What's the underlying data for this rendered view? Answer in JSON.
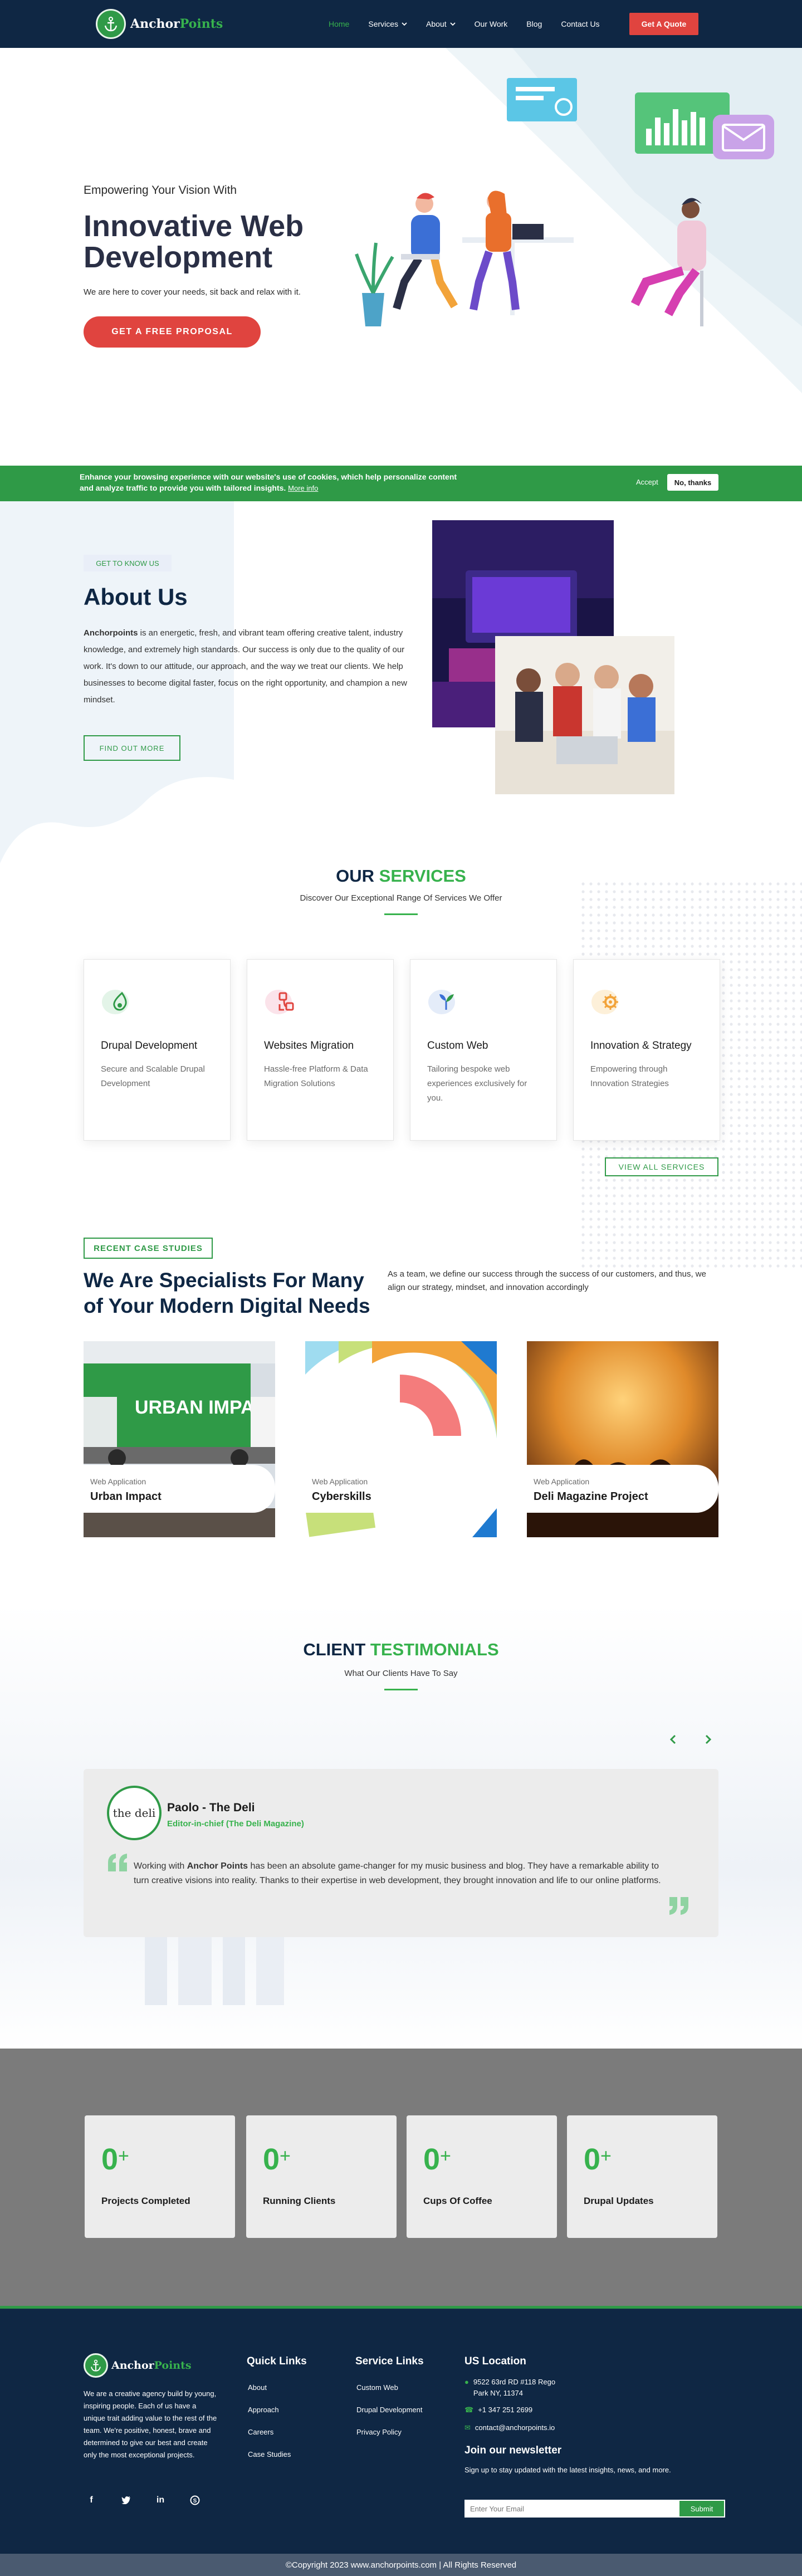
{
  "header": {
    "logo": {
      "part1": "Anchor",
      "part2": "Points"
    },
    "nav": [
      {
        "label": "Home"
      },
      {
        "label": "Services"
      },
      {
        "label": "About"
      },
      {
        "label": "Our Work"
      },
      {
        "label": "Blog"
      },
      {
        "label": "Contact Us"
      }
    ],
    "cta": "Get A Quote"
  },
  "hero": {
    "eyebrow": "Empowering Your Vision With",
    "title": "Innovative Web Development",
    "subtitle": "We are here to cover your needs, sit back and relax with it.",
    "button": "GET A FREE PROPOSAL"
  },
  "cookie": {
    "text": "Enhance your browsing experience with our website's use of cookies, which help personalize content and analyze traffic to provide you with tailored insights.",
    "more": "More info",
    "accept": "Accept",
    "decline": "No, thanks"
  },
  "about": {
    "tag": "GET TO KNOW US",
    "title": "About Us",
    "brand": "Anchorpoints",
    "body": " is an energetic, fresh, and vibrant team offering creative talent, industry knowledge, and extremely high standards. Our success is only due to the quality of our work. It's down to our attitude, our approach, and the way we treat our clients. We help businesses to become digital faster, focus on the right opportunity, and champion a new mindset.",
    "button": "FIND OUT MORE"
  },
  "services": {
    "title_a": "OUR ",
    "title_b": "SERVICES",
    "subtitle": "Discover Our Exceptional Range Of Services We Offer",
    "items": [
      {
        "name": "Drupal Development",
        "desc": "Secure and Scalable Drupal Development"
      },
      {
        "name": "Websites Migration",
        "desc": "Hassle-free Platform & Data Migration Solutions"
      },
      {
        "name": "Custom Web",
        "desc": "Tailoring bespoke web experiences exclusively for you."
      },
      {
        "name": "Innovation & Strategy",
        "desc": "Empowering through Innovation Strategies"
      }
    ],
    "view_all": "VIEW ALL SERVICES"
  },
  "cases": {
    "tag": "RECENT CASE STUDIES",
    "title": "We Are Specialists For Many of Your Modern Digital Needs",
    "desc": "As a team, we define our success through the success of our customers, and thus, we align our strategy, mindset, and innovation accordingly",
    "items": [
      {
        "category": "Web Application",
        "name": "Urban Impact",
        "img_text": "URBAN IMPACT"
      },
      {
        "category": "Web Application",
        "name": "Cyberskills"
      },
      {
        "category": "Web Application",
        "name": "Deli Magazine Project"
      }
    ]
  },
  "testimonials": {
    "title_a": "CLIENT ",
    "title_b": "TESTIMONIALS",
    "subtitle": "What Our Clients Have To Say",
    "item": {
      "avatar_text": "the deli",
      "name": "Paolo - The Deli",
      "role": "Editor-in-chief (The Deli Magazine)",
      "quote_pre": "Working with ",
      "quote_brand": "Anchor Points",
      "quote_post": " has been an absolute game-changer for my music business and blog. They have a remarkable ability to turn creative visions into reality. Thanks to their expertise in web development, they brought innovation and life to our online platforms."
    }
  },
  "counters": [
    {
      "value": "0",
      "suffix": "+",
      "label": "Projects Completed"
    },
    {
      "value": "0",
      "suffix": "+",
      "label": "Running Clients"
    },
    {
      "value": "0",
      "suffix": "+",
      "label": "Cups Of Coffee"
    },
    {
      "value": "0",
      "suffix": "+",
      "label": "Drupal Updates"
    }
  ],
  "footer": {
    "logo": {
      "part1": "Anchor",
      "part2": "Points"
    },
    "about": "We are a creative agency build by young, inspiring people. Each of us have a unique trait adding value to the rest of the team. We're positive, honest, brave and determined to give our best and create only the most exceptional projects.",
    "quick_links_title": "Quick Links",
    "quick_links": [
      "About",
      "Approach",
      "Careers",
      "Case Studies"
    ],
    "service_links_title": "Service Links",
    "service_links": [
      "Custom Web",
      "Drupal Development",
      "Privacy Policy"
    ],
    "location_title": "US Location",
    "address_line1": "9522 63rd RD #118 Rego",
    "address_line2": "Park NY, 11374",
    "phone": "+1 347 251 2699",
    "email": "contact@anchorpoints.io",
    "newsletter_title": "Join our newsletter",
    "newsletter_sub": "Sign up to stay updated with the latest insights, news, and more.",
    "email_placeholder": "Enter Your Email",
    "submit": "Submit",
    "copyright": "©Copyright 2023 www.anchorpoints.com | All Rights Reserved"
  },
  "colors": {
    "navy": "#0f2744",
    "green": "#2f9a47",
    "red": "#e0443f",
    "gray": "#7b7b7b"
  }
}
